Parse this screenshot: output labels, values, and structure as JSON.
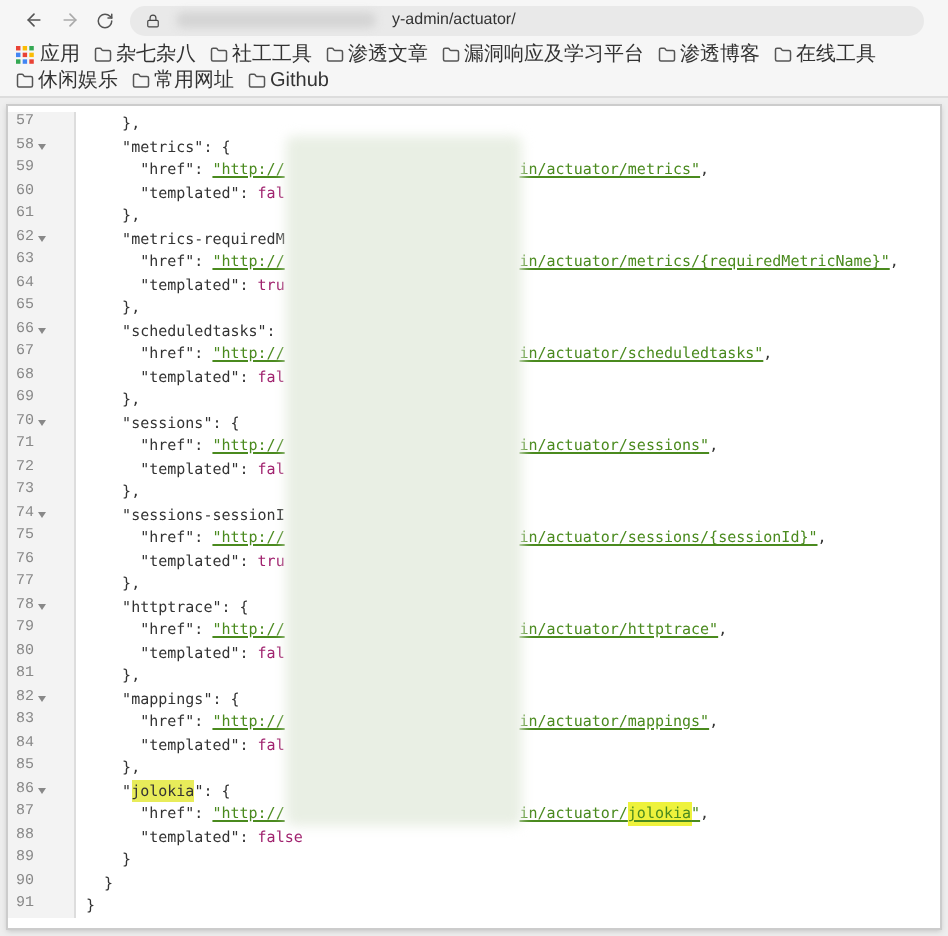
{
  "browser": {
    "url_visible": "y-admin/actuator/",
    "bookmarks": [
      {
        "label": "应用",
        "kind": "apps"
      },
      {
        "label": "杂七杂八",
        "kind": "folder"
      },
      {
        "label": "社工工具",
        "kind": "folder"
      },
      {
        "label": "渗透文章",
        "kind": "folder"
      },
      {
        "label": "漏洞响应及学习平台",
        "kind": "folder"
      },
      {
        "label": "渗透博客",
        "kind": "folder"
      },
      {
        "label": "在线工具",
        "kind": "folder"
      },
      {
        "label": "休闲娱乐",
        "kind": "folder"
      },
      {
        "label": "常用网址",
        "kind": "folder"
      },
      {
        "label": "Github",
        "kind": "folder"
      }
    ]
  },
  "code": {
    "lines": [
      {
        "n": "57",
        "left": [
          {
            "text": "    },",
            "kind": "plain"
          }
        ]
      },
      {
        "n": "58",
        "fold": true,
        "left": [
          {
            "text": "    \"metrics\": {",
            "kind": "plain"
          }
        ]
      },
      {
        "n": "59",
        "left": [
          {
            "text": "      \"href\": ",
            "kind": "plain"
          },
          {
            "text": "\"http://",
            "kind": "link"
          }
        ],
        "right": [
          {
            "text": "in/actuator/metrics\"",
            "kind": "link"
          },
          {
            "text": ",",
            "kind": "plain"
          }
        ]
      },
      {
        "n": "60",
        "left": [
          {
            "text": "      \"templated\": ",
            "kind": "plain"
          },
          {
            "text": "fal",
            "kind": "bool"
          }
        ]
      },
      {
        "n": "61",
        "left": [
          {
            "text": "    },",
            "kind": "plain"
          }
        ]
      },
      {
        "n": "62",
        "fold": true,
        "left": [
          {
            "text": "    \"metrics-requiredM",
            "kind": "plain"
          }
        ]
      },
      {
        "n": "63",
        "left": [
          {
            "text": "      \"href\": ",
            "kind": "plain"
          },
          {
            "text": "\"http://",
            "kind": "link"
          }
        ],
        "right": [
          {
            "text": "in/actuator/metrics/{requiredMetricName}\"",
            "kind": "link"
          },
          {
            "text": ",",
            "kind": "plain"
          }
        ]
      },
      {
        "n": "64",
        "left": [
          {
            "text": "      \"templated\": ",
            "kind": "plain"
          },
          {
            "text": "tru",
            "kind": "bool"
          }
        ]
      },
      {
        "n": "65",
        "left": [
          {
            "text": "    },",
            "kind": "plain"
          }
        ]
      },
      {
        "n": "66",
        "fold": true,
        "left": [
          {
            "text": "    \"scheduledtasks\":",
            "kind": "plain"
          }
        ]
      },
      {
        "n": "67",
        "left": [
          {
            "text": "      \"href\": ",
            "kind": "plain"
          },
          {
            "text": "\"http://",
            "kind": "link"
          }
        ],
        "right": [
          {
            "text": "in/actuator/scheduledtasks\"",
            "kind": "link"
          },
          {
            "text": ",",
            "kind": "plain"
          }
        ]
      },
      {
        "n": "68",
        "left": [
          {
            "text": "      \"templated\": ",
            "kind": "plain"
          },
          {
            "text": "fal",
            "kind": "bool"
          }
        ]
      },
      {
        "n": "69",
        "left": [
          {
            "text": "    },",
            "kind": "plain"
          }
        ]
      },
      {
        "n": "70",
        "fold": true,
        "left": [
          {
            "text": "    \"sessions\": {",
            "kind": "plain"
          }
        ]
      },
      {
        "n": "71",
        "left": [
          {
            "text": "      \"href\": ",
            "kind": "plain"
          },
          {
            "text": "\"http://",
            "kind": "link"
          }
        ],
        "right": [
          {
            "text": "in/actuator/sessions\"",
            "kind": "link"
          },
          {
            "text": ",",
            "kind": "plain"
          }
        ]
      },
      {
        "n": "72",
        "left": [
          {
            "text": "      \"templated\": ",
            "kind": "plain"
          },
          {
            "text": "fal",
            "kind": "bool"
          }
        ]
      },
      {
        "n": "73",
        "left": [
          {
            "text": "    },",
            "kind": "plain"
          }
        ]
      },
      {
        "n": "74",
        "fold": true,
        "left": [
          {
            "text": "    \"sessions-sessionI",
            "kind": "plain"
          }
        ]
      },
      {
        "n": "75",
        "left": [
          {
            "text": "      \"href\": ",
            "kind": "plain"
          },
          {
            "text": "\"http://",
            "kind": "link"
          }
        ],
        "right": [
          {
            "text": "in/actuator/sessions/{sessionId}\"",
            "kind": "link"
          },
          {
            "text": ",",
            "kind": "plain"
          }
        ]
      },
      {
        "n": "76",
        "left": [
          {
            "text": "      \"templated\": ",
            "kind": "plain"
          },
          {
            "text": "tru",
            "kind": "bool"
          }
        ]
      },
      {
        "n": "77",
        "left": [
          {
            "text": "    },",
            "kind": "plain"
          }
        ]
      },
      {
        "n": "78",
        "fold": true,
        "left": [
          {
            "text": "    \"httptrace\": {",
            "kind": "plain"
          }
        ]
      },
      {
        "n": "79",
        "left": [
          {
            "text": "      \"href\": ",
            "kind": "plain"
          },
          {
            "text": "\"http://",
            "kind": "link"
          }
        ],
        "right": [
          {
            "text": "in/actuator/httptrace\"",
            "kind": "link"
          },
          {
            "text": ",",
            "kind": "plain"
          }
        ]
      },
      {
        "n": "80",
        "left": [
          {
            "text": "      \"templated\": ",
            "kind": "plain"
          },
          {
            "text": "fal",
            "kind": "bool"
          }
        ]
      },
      {
        "n": "81",
        "left": [
          {
            "text": "    },",
            "kind": "plain"
          }
        ]
      },
      {
        "n": "82",
        "fold": true,
        "left": [
          {
            "text": "    \"mappings\": {",
            "kind": "plain"
          }
        ]
      },
      {
        "n": "83",
        "left": [
          {
            "text": "      \"href\": ",
            "kind": "plain"
          },
          {
            "text": "\"http://",
            "kind": "link"
          }
        ],
        "right": [
          {
            "text": "in/actuator/mappings\"",
            "kind": "link"
          },
          {
            "text": ",",
            "kind": "plain"
          }
        ]
      },
      {
        "n": "84",
        "left": [
          {
            "text": "      \"templated\": ",
            "kind": "plain"
          },
          {
            "text": "fal",
            "kind": "bool"
          }
        ]
      },
      {
        "n": "85",
        "left": [
          {
            "text": "    },",
            "kind": "plain"
          }
        ]
      },
      {
        "n": "86",
        "fold": true,
        "left": [
          {
            "text": "    \"",
            "kind": "plain"
          },
          {
            "text": "jolokia",
            "kind": "match"
          },
          {
            "text": "\": {",
            "kind": "plain"
          }
        ]
      },
      {
        "n": "87",
        "left": [
          {
            "text": "      \"href\": ",
            "kind": "plain"
          },
          {
            "text": "\"http://",
            "kind": "link"
          }
        ],
        "right": [
          {
            "text": "in/actuator/",
            "kind": "link"
          },
          {
            "text": "jolokia",
            "kind": "link-match"
          },
          {
            "text": "\"",
            "kind": "link"
          },
          {
            "text": ",",
            "kind": "plain"
          }
        ]
      },
      {
        "n": "88",
        "left": [
          {
            "text": "      \"templated\": ",
            "kind": "plain"
          },
          {
            "text": "false",
            "kind": "bool"
          }
        ]
      },
      {
        "n": "89",
        "left": [
          {
            "text": "    }",
            "kind": "plain"
          }
        ]
      },
      {
        "n": "90",
        "left": [
          {
            "text": "  }",
            "kind": "plain"
          }
        ]
      },
      {
        "n": "91",
        "left": [
          {
            "text": "}",
            "kind": "plain"
          }
        ]
      }
    ]
  }
}
